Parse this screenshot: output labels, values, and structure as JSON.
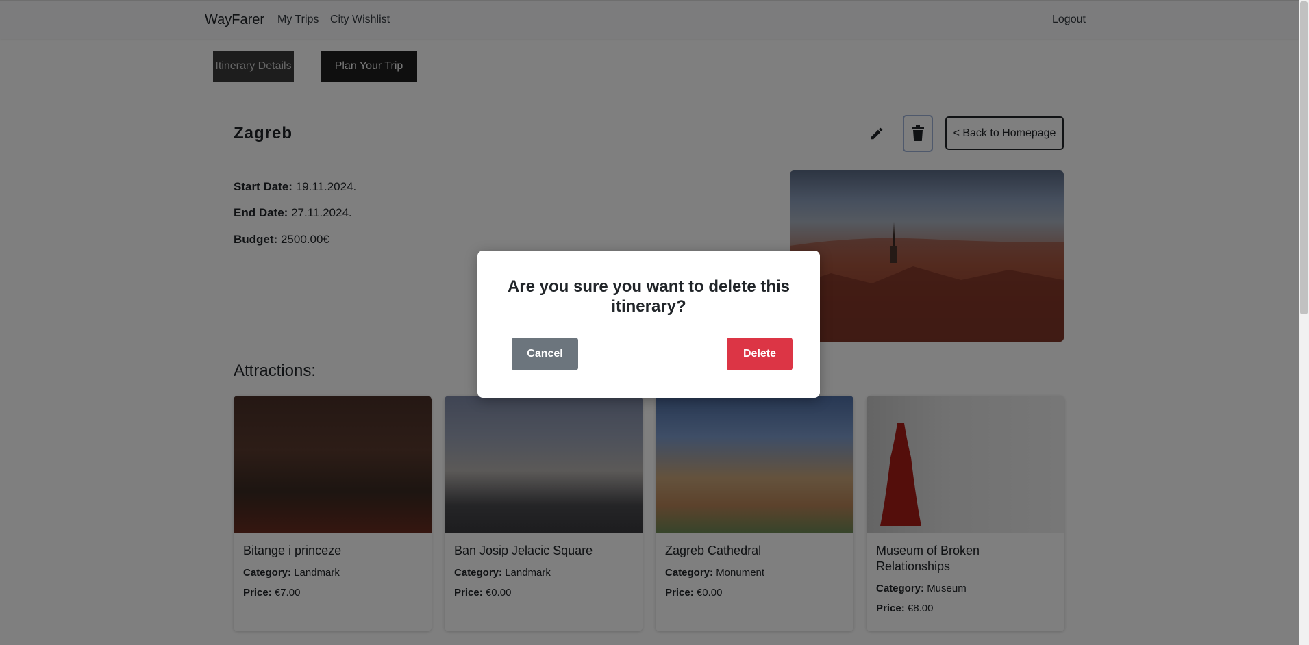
{
  "navbar": {
    "brand": "WayFarer",
    "links": [
      "My Trips",
      "City Wishlist"
    ],
    "logout": "Logout"
  },
  "tabs": [
    "Itinerary Details",
    "Plan Your Trip"
  ],
  "itinerary": {
    "city": "Zagreb",
    "start_label": "Start Date:",
    "start_value": "19.11.2024.",
    "end_label": "End Date:",
    "end_value": "27.11.2024.",
    "budget_label": "Budget:",
    "budget_value": "2500.00€",
    "back_button": "< Back to Homepage",
    "edit_icon": "pencil-icon",
    "delete_icon": "trash-icon"
  },
  "attractions": {
    "heading": "Attractions:",
    "category_label": "Category:",
    "price_label": "Price:",
    "items": [
      {
        "name": "Bitange i princeze",
        "category": "Landmark",
        "price": "€7.00"
      },
      {
        "name": "Ban Josip Jelacic Square",
        "category": "Landmark",
        "price": "€0.00"
      },
      {
        "name": "Zagreb Cathedral",
        "category": "Monument",
        "price": "€0.00"
      },
      {
        "name": "Museum of Broken Relationships",
        "category": "Museum",
        "price": "€8.00"
      }
    ]
  },
  "modal": {
    "message": "Are you sure you want to delete this itinerary?",
    "cancel": "Cancel",
    "delete": "Delete"
  },
  "colors": {
    "danger": "#dc3545",
    "secondary": "#6c757d",
    "dark": "#212529"
  }
}
